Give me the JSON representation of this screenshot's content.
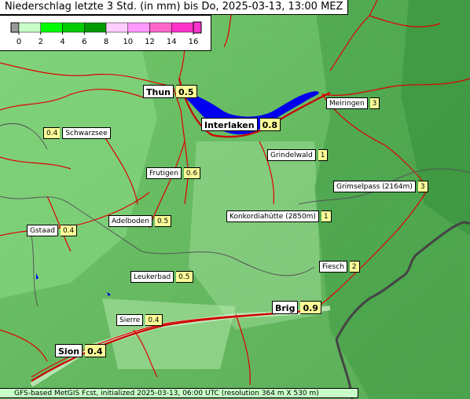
{
  "title": "Niederschlag letzte 3 Std. (in mm) bis Do, 2025-03-13, 13:00 MEZ",
  "legend": {
    "ticks": [
      "0",
      "2",
      "4",
      "6",
      "8",
      "10",
      "12",
      "14",
      "16"
    ],
    "colors": [
      "#999999",
      "#c8ffc8",
      "#00ff00",
      "#00cc00",
      "#009900",
      "#ffccff",
      "#ff99ff",
      "#ff66cc",
      "#ff33cc"
    ]
  },
  "places": [
    {
      "name": "Thun",
      "value": "0.5",
      "big": true
    },
    {
      "name": "Interlaken",
      "value": "0.8",
      "big": true
    },
    {
      "name": "Meiringen",
      "value": "3"
    },
    {
      "name": "Schwarzsee",
      "value": "0.4",
      "value_first": true
    },
    {
      "name": "Grindelwald",
      "value": "1"
    },
    {
      "name": "Frutigen",
      "value": "0.6"
    },
    {
      "name": "Grimselpass (2164m)",
      "value": "3"
    },
    {
      "name": "Konkordiahütte (2850m)",
      "value": "1"
    },
    {
      "name": "Adelboden",
      "value": "0.5"
    },
    {
      "name": "Gstaad",
      "value": "0.4"
    },
    {
      "name": "Fiesch",
      "value": "2"
    },
    {
      "name": "Leukerbad",
      "value": "0.5"
    },
    {
      "name": "Brig",
      "value": "0.9",
      "big": true
    },
    {
      "name": "Sierre",
      "value": "0.4"
    },
    {
      "name": "Sion",
      "value": "0.4",
      "big": true
    }
  ],
  "footer": "GFS-based MetGIS Fcst, initialized 2025-03-13, 06:00 UTC  (resolution 364 m X 530 m)"
}
